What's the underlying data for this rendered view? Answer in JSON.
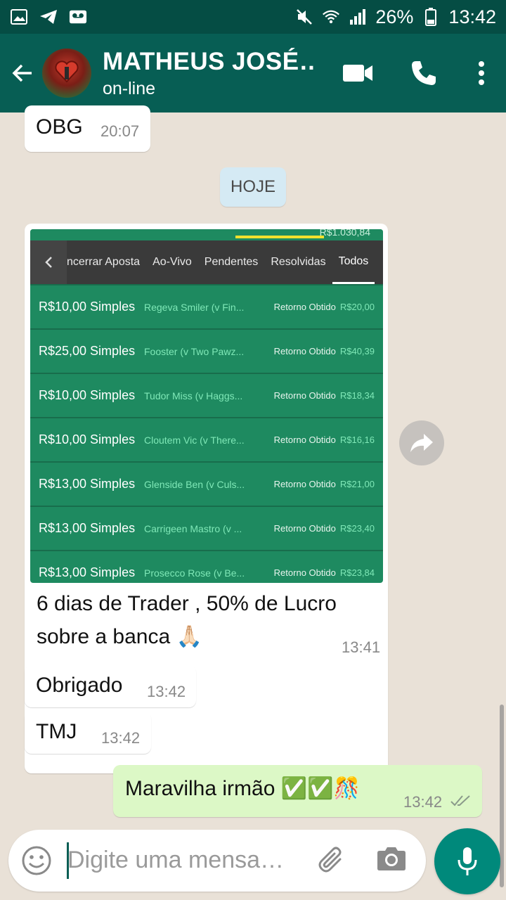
{
  "status_bar": {
    "battery": "26%",
    "time": "13:42"
  },
  "header": {
    "contact_name": "MATHEUS JOSÉ…",
    "status": "on-line"
  },
  "messages": {
    "m1": {
      "text": "OBG",
      "time": "20:07"
    },
    "date_chip": "HOJE",
    "image_msg": {
      "caption_line1": "6 dias de Trader , 50% de Lucro",
      "caption_line2": "sobre a banca 🙏🏻",
      "time": "13:41",
      "screenshot": {
        "balance_partial": "R$1.030,84",
        "tabs": [
          "ncerrar Aposta",
          "Ao-Vivo",
          "Pendentes",
          "Resolvidas",
          "Todos"
        ],
        "active_tab": "Todos",
        "bets": [
          {
            "amount": "R$10,00 Simples",
            "selection": "Regeva Smiler (v Fin...",
            "label": "Retorno Obtido",
            "return": "R$20,00"
          },
          {
            "amount": "R$25,00 Simples",
            "selection": "Fooster (v Two Pawz...",
            "label": "Retorno Obtido",
            "return": "R$40,39"
          },
          {
            "amount": "R$10,00 Simples",
            "selection": "Tudor Miss (v Haggs...",
            "label": "Retorno Obtido",
            "return": "R$18,34"
          },
          {
            "amount": "R$10,00 Simples",
            "selection": "Cloutem Vic (v There...",
            "label": "Retorno Obtido",
            "return": "R$16,16"
          },
          {
            "amount": "R$13,00 Simples",
            "selection": "Glenside Ben (v Culs...",
            "label": "Retorno Obtido",
            "return": "R$21,00"
          },
          {
            "amount": "R$13,00 Simples",
            "selection": "Carrigeen Mastro (v ...",
            "label": "Retorno Obtido",
            "return": "R$23,40"
          },
          {
            "amount": "R$13,00 Simples",
            "selection": "Prosecco Rose (v Be...",
            "label": "Retorno Obtido",
            "return": "R$23,84"
          }
        ]
      }
    },
    "m3": {
      "text": "Obrigado",
      "time": "13:42"
    },
    "m4": {
      "text": "TMJ",
      "time": "13:42"
    },
    "m5": {
      "text": "Maravilha irmão ✅✅🎊",
      "time": "13:42"
    }
  },
  "input": {
    "placeholder": "Digite uma mensa…"
  },
  "colors": {
    "header": "#075e54",
    "status_bar": "#054d44",
    "chat_bg": "#e9e1d7",
    "outgoing_bubble": "#dcf8c6",
    "bet_panel": "#1e8a60",
    "fab": "#00897b"
  }
}
